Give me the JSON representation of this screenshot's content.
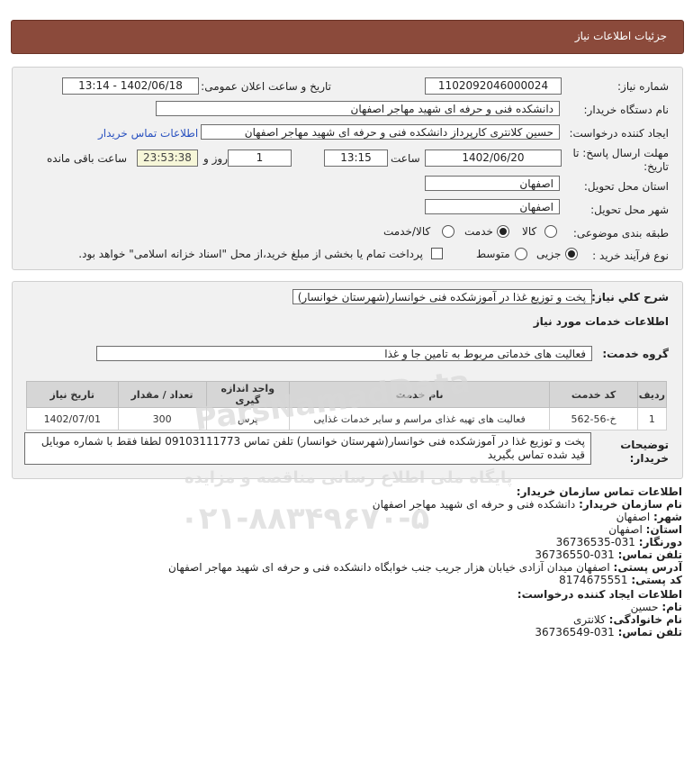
{
  "header": {
    "title": "جزئیات اطلاعات نیاز"
  },
  "form": {
    "need_number_label": "شماره نیاز:",
    "need_number": "1102092046000024",
    "announce_label": "تاریخ و ساعت اعلان عمومی:",
    "announce_value": "1402/06/18 - 13:14",
    "buyer_label": "نام دستگاه خریدار:",
    "buyer_value": "دانشکده فنی و حرفه ای شهید مهاجر اصفهان",
    "creator_label": "ایجاد کننده درخواست:",
    "creator_value": "حسین کلانتری کارپرداز دانشکده فنی و حرفه ای شهید مهاجر اصفهان",
    "contact_link": "اطلاعات تماس خریدار",
    "deadline_label_1": "مهلت ارسال پاسخ: تا",
    "deadline_label_2": "تاریخ:",
    "deadline_date": "1402/06/20",
    "time_label": "ساعت",
    "deadline_time": "13:15",
    "days_value": "1",
    "days_label": "روز و",
    "remaining_value": "23:53:38",
    "remaining_label": "ساعت باقی مانده",
    "province_label": "استان محل تحویل:",
    "province_value": "اصفهان",
    "city_label": "شهر محل تحویل:",
    "city_value": "اصفهان",
    "category_label": "طبقه بندی موضوعی:",
    "category_options": [
      "کالا",
      "خدمت",
      "کالا/خدمت"
    ],
    "category_selected": "خدمت",
    "process_label": "نوع فرآیند خرید :",
    "process_options": [
      "جزیی",
      "متوسط"
    ],
    "process_selected": "جزیی",
    "treasury_text": "پرداخت تمام یا بخشی از مبلغ خرید،از محل \"اسناد خزانه اسلامی\" خواهد بود."
  },
  "need": {
    "general_label": "شرح کلي نياز:",
    "general_value": "پخت و توزیع غذا در آموزشکده فنی خوانسار(شهرستان خوانسار)",
    "services_heading": "اطلاعات خدمات مورد نیاز",
    "group_label": "گروه خدمت:",
    "group_value": "فعالیت های خدماتی مربوط به تامین جا و غذا",
    "table": {
      "headers": [
        "ردیف",
        "کد خدمت",
        "نام خدمت",
        "واحد اندازه گیری",
        "تعداد / مقدار",
        "تاریخ نیاز"
      ],
      "rows": [
        [
          "1",
          "خ-56-562",
          "فعالیت های تهیه غذای مراسم و سایر خدمات غذایی",
          "پرس",
          "300",
          "1402/07/01"
        ]
      ]
    },
    "notes_label_1": "توضیحات",
    "notes_label_2": "خریدار:",
    "notes_value": "پخت و توزیع غذا در آموزشکده فنی خوانسار(شهرستان خوانسار) تلفن تماس 09103111773 لطفا فقط با شماره موبایل قید شده تماس بگیرید"
  },
  "contact": {
    "org_heading": "اطلاعات تماس سازمان خریدار:",
    "org_name_label": "نام سازمان خریدار:",
    "org_name": "دانشکده فنی و حرفه ای شهید مهاجر اصفهان",
    "city_label": "شهر:",
    "city": "اصفهان",
    "province_label": "استان:",
    "province": "اصفهان",
    "fax_label": "دورنگار:",
    "fax": "031-36736535",
    "phone_label": "تلفن تماس:",
    "phone": "031-36736550",
    "address_label": "آدرس پستی:",
    "address": "اصفهان میدان آزادی خیابان هزار جریب جنب خوابگاه دانشکده فنی و حرفه ای شهید مهاجر اصفهان",
    "postal_label": "کد پستی:",
    "postal": "8174675551",
    "creator_heading": "اطلاعات ایجاد کننده درخواست:",
    "first_name_label": "نام:",
    "first_name": "حسین",
    "last_name_label": "نام خانوادگی:",
    "last_name": "کلانتری",
    "creator_phone_label": "تلفن تماس:",
    "creator_phone": "031-36736549"
  },
  "watermark": {
    "brand": "ParsNamadData",
    "slogan": "پایگاه ملی اطلاع رسانی مناقصه و مزایده",
    "phone": "۰۲۱-۸۸۳۴۹۶۷۰-۵"
  }
}
